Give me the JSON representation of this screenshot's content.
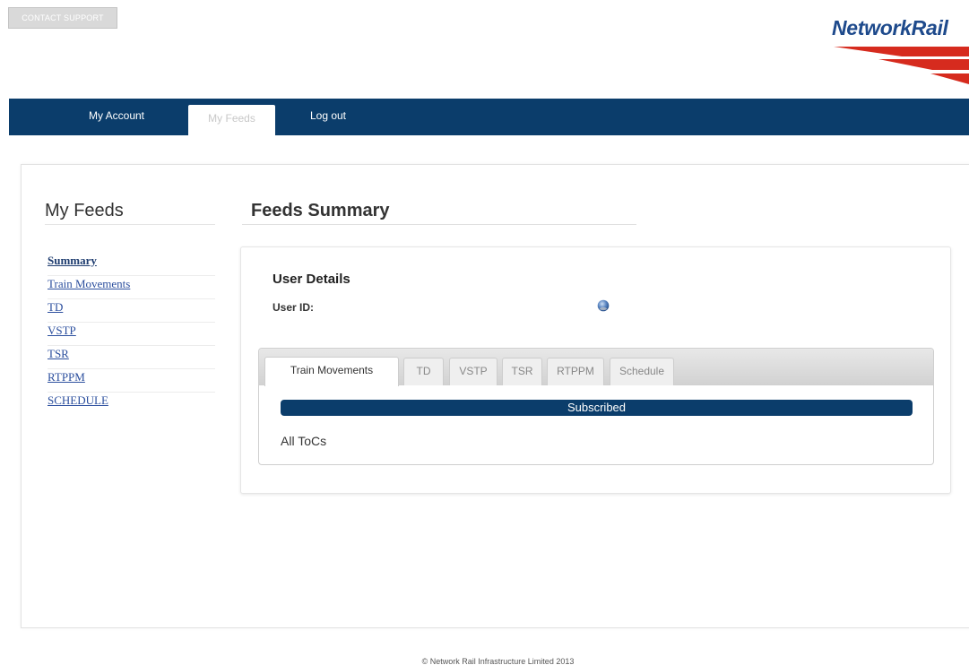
{
  "header": {
    "contact_support": "CONTACT SUPPORT",
    "logo_text": "NetworkRail"
  },
  "nav": {
    "items": [
      {
        "label": "My Account"
      },
      {
        "label": "My Feeds"
      },
      {
        "label": "Log out"
      }
    ],
    "active": "My Feeds"
  },
  "sidebar": {
    "title": "My Feeds",
    "items": [
      {
        "label": "Summary"
      },
      {
        "label": "Train Movements"
      },
      {
        "label": "TD"
      },
      {
        "label": "VSTP"
      },
      {
        "label": "TSR"
      },
      {
        "label": "RTPPM"
      },
      {
        "label": "SCHEDULE"
      }
    ]
  },
  "main": {
    "title": "Feeds Summary",
    "user_details": {
      "heading": "User Details",
      "user_id_label": "User ID:"
    },
    "tabs": [
      {
        "label": "Train Movements"
      },
      {
        "label": "TD"
      },
      {
        "label": "VSTP"
      },
      {
        "label": "TSR"
      },
      {
        "label": "RTPPM"
      },
      {
        "label": "Schedule"
      }
    ],
    "selected_tab": "Train Movements",
    "status": "Subscribed",
    "tocs": "All ToCs"
  },
  "footer": {
    "copyright": "© Network Rail Infrastructure Limited 2013"
  },
  "colors": {
    "brand_navy": "#0b3d6b",
    "logo_blue": "#1e4a8c",
    "logo_red": "#d62b1e",
    "link_blue": "#2c4f9e"
  },
  "icons": {
    "user_status": "globe-icon"
  }
}
